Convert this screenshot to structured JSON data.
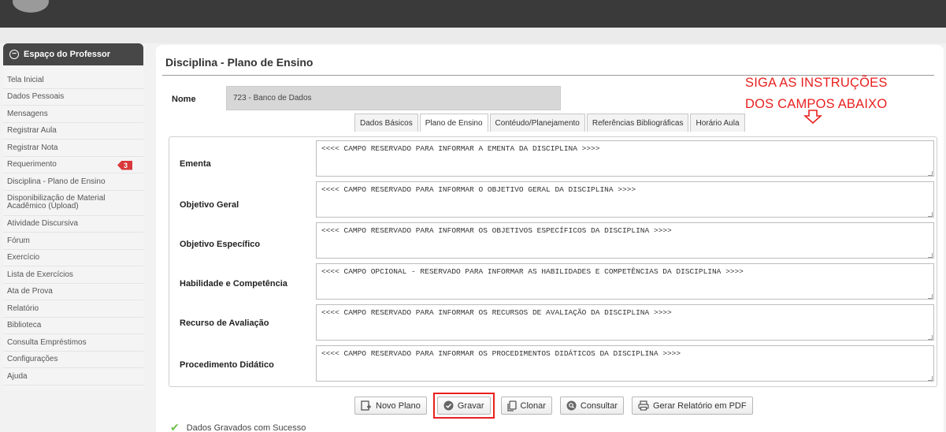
{
  "sidebar": {
    "header": "Espaço do Professor",
    "items": [
      {
        "label": "Tela Inicial"
      },
      {
        "label": "Dados Pessoais"
      },
      {
        "label": "Mensagens"
      },
      {
        "label": "Registrar Aula"
      },
      {
        "label": "Registrar Nota"
      },
      {
        "label": "Requerimento",
        "badge": "3"
      },
      {
        "label": "Disciplina - Plano de Ensino"
      },
      {
        "label": "Disponibilização de Material Acadêmico (Upload)"
      },
      {
        "label": "Atividade Discursiva"
      },
      {
        "label": "Fórum"
      },
      {
        "label": "Exercício"
      },
      {
        "label": "Lista de Exercícios"
      },
      {
        "label": "Ata de Prova"
      },
      {
        "label": "Relatório"
      },
      {
        "label": "Biblioteca"
      },
      {
        "label": "Consulta Empréstimos"
      },
      {
        "label": "Configurações"
      },
      {
        "label": "Ajuda"
      }
    ]
  },
  "main": {
    "title": "Disciplina - Plano de Ensino",
    "nome_label": "Nome",
    "nome_value": "723 - Banco de Dados",
    "annotation": {
      "line1": "SIGA AS INSTRUÇÕES",
      "line2": "DOS CAMPOS ABAIXO",
      "color": "#e8201f"
    },
    "tabs": [
      {
        "label": "Dados Básicos"
      },
      {
        "label": "Plano de Ensino",
        "active": true
      },
      {
        "label": "Contéudo/Planejamento"
      },
      {
        "label": "Referências Bibliográficas"
      },
      {
        "label": "Horário Aula"
      }
    ],
    "fields": [
      {
        "label": "Ementa",
        "value": "<<<< CAMPO RESERVADO PARA INFORMAR A EMENTA DA DISCIPLINA >>>>"
      },
      {
        "label": "Objetivo Geral",
        "value": "<<<< CAMPO RESERVADO PARA INFORMAR O OBJETIVO GERAL DA DISCIPLINA >>>>"
      },
      {
        "label": "Objetivo Específico",
        "value": "<<<< CAMPO RESERVADO PARA INFORMAR OS OBJETIVOS ESPECÍFICOS DA DISCIPLINA >>>>"
      },
      {
        "label": "Habilidade e Competência",
        "value": "<<<< CAMPO OPCIONAL - RESERVADO PARA INFORMAR AS HABILIDADES E COMPETÊNCIAS DA DISCIPLINA >>>>"
      },
      {
        "label": "Recurso de Avaliação",
        "value": "<<<< CAMPO RESERVADO PARA INFORMAR OS RECURSOS DE AVALIAÇÃO DA DISCIPLINA >>>>"
      },
      {
        "label": "Procedimento Didático",
        "value": "<<<< CAMPO RESERVADO PARA INFORMAR OS PROCEDIMENTOS DIDÁTICOS DA DISCIPLINA >>>>"
      }
    ],
    "buttons": {
      "novo_plano": "Novo Plano",
      "gravar": "Gravar",
      "clonar": "Clonar",
      "consultar": "Consultar",
      "gerar_pdf": "Gerar Relatório em PDF"
    },
    "success_message": "Dados Gravados com Sucesso"
  }
}
